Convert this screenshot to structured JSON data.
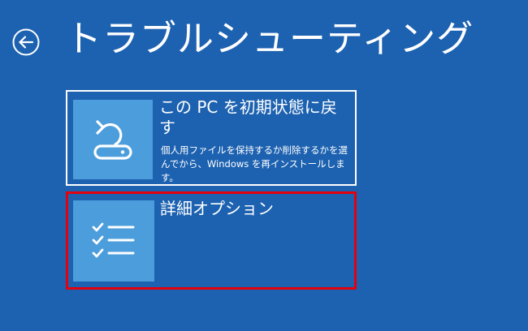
{
  "header": {
    "title": "トラブルシューティング",
    "back_icon": "arrow-left-circle-icon"
  },
  "options": [
    {
      "title": "この PC を初期状態に戻す",
      "description": "個人用ファイルを保持するか削除するかを選んでから、Windows を再インストールします。",
      "icon": "reset-pc-icon"
    },
    {
      "title": "詳細オプション",
      "icon": "checklist-icon"
    }
  ],
  "colors": {
    "background": "#1d62b0",
    "icon_tile": "#4c9ddc",
    "focus_border": "#ffffff",
    "highlight_border": "#e3000f",
    "text": "#ffffff"
  }
}
